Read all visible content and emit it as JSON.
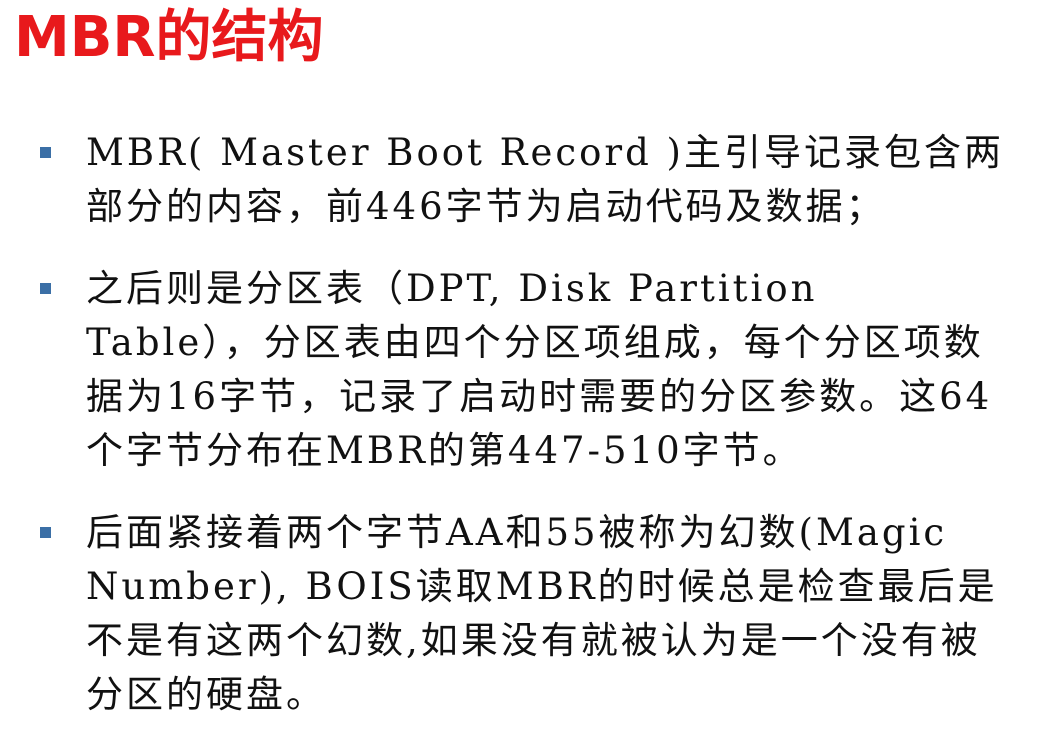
{
  "slide": {
    "title": "MBR的结构",
    "bullets": [
      "MBR( Master Boot Record )主引导记录包含两部分的内容，前446字节为启动代码及数据；",
      "之后则是分区表（DPT, Disk Partition Table），分区表由四个分区项组成，每个分区项数据为16字节，记录了启动时需要的分区参数。这64个字节分布在MBR的第447-510字节。",
      "后面紧接着两个字节AA和55被称为幻数(Magic Number), BOIS读取MBR的时候总是检查最后是不是有这两个幻数,如果没有就被认为是一个没有被分区的硬盘。"
    ]
  },
  "colors": {
    "title": "#e8191c",
    "bullet_marker": "#3b6fa6",
    "text": "#111111"
  },
  "icons": {
    "bullet": "square-bullet-icon"
  }
}
